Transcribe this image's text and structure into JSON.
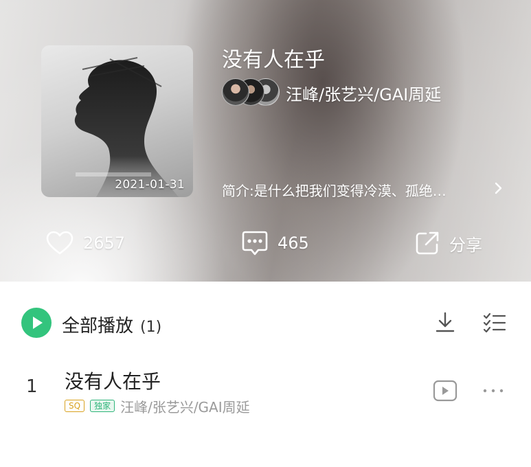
{
  "album": {
    "title": "没有人在乎",
    "artists": "汪峰/张艺兴/GAI周延",
    "release_date": "2021-01-31",
    "intro": "简介:是什么把我们变得冷漠、孤绝…"
  },
  "stats": {
    "likes": "2657",
    "comments": "465",
    "share_label": "分享"
  },
  "playlist": {
    "play_all_label": "全部播放",
    "count": "(1)"
  },
  "tracks": [
    {
      "index": "1",
      "title": "没有人在乎",
      "badges": [
        "SQ",
        "独家"
      ],
      "artists": "汪峰/张艺兴/GAI周延"
    }
  ],
  "colors": {
    "accent_green": "#33c47d",
    "sq_badge": "#d9a21e",
    "exclusive_badge": "#2fb57a"
  },
  "icons": [
    "heart-icon",
    "comment-icon",
    "share-icon",
    "play-icon",
    "download-icon",
    "multi-select-icon",
    "mv-icon",
    "more-icon",
    "chevron-right-icon"
  ]
}
